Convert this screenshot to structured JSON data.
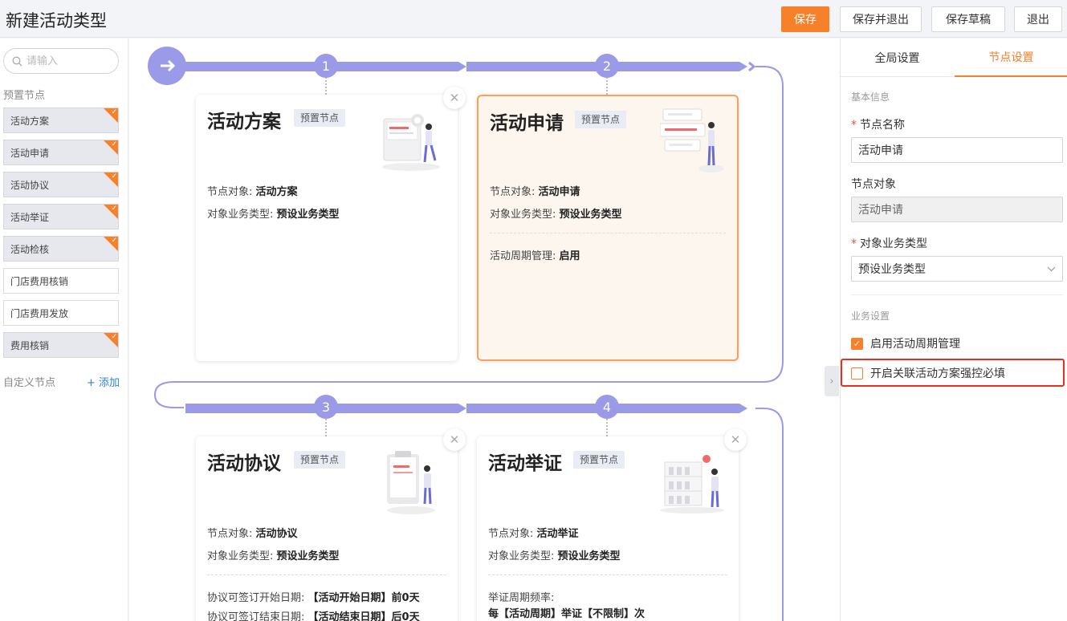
{
  "header": {
    "title": "新建活动类型",
    "save_label": "保存",
    "save_exit_label": "保存并退出",
    "save_draft_label": "保存草稿",
    "exit_label": "退出"
  },
  "sidebar": {
    "search_placeholder": "请输入",
    "preset_label": "预置节点",
    "custom_label": "自定义节点",
    "add_label": "+ 添加",
    "items": [
      {
        "label": "活动方案",
        "preset": true
      },
      {
        "label": "活动申请",
        "preset": true
      },
      {
        "label": "活动协议",
        "preset": true
      },
      {
        "label": "活动举证",
        "preset": true
      },
      {
        "label": "活动检核",
        "preset": true
      },
      {
        "label": "门店费用核销",
        "preset": false
      },
      {
        "label": "门店费用发放",
        "preset": false
      },
      {
        "label": "费用核销",
        "preset": true
      }
    ]
  },
  "flow": {
    "steps": [
      "1",
      "2",
      "3",
      "4"
    ],
    "cards": [
      {
        "title": "活动方案",
        "tag": "预置节点",
        "object_label": "节点对象:",
        "object_value": "活动方案",
        "biz_label": "对象业务类型:",
        "biz_value": "预设业务类型"
      },
      {
        "title": "活动申请",
        "tag": "预置节点",
        "object_label": "节点对象:",
        "object_value": "活动申请",
        "biz_label": "对象业务类型:",
        "biz_value": "预设业务类型",
        "extra_label": "活动周期管理:",
        "extra_value": "启用"
      },
      {
        "title": "活动协议",
        "tag": "预置节点",
        "object_label": "节点对象:",
        "object_value": "活动协议",
        "biz_label": "对象业务类型:",
        "biz_value": "预设业务类型",
        "extra_label": "协议可签订开始日期:",
        "extra_value": "【活动开始日期】前0天",
        "extra2_label": "协议可签订结束日期:",
        "extra2_value": "【活动结束日期】后0天"
      },
      {
        "title": "活动举证",
        "tag": "预置节点",
        "object_label": "节点对象:",
        "object_value": "活动举证",
        "biz_label": "对象业务类型:",
        "biz_value": "预设业务类型",
        "extra_label": "举证周期频率:",
        "extra_value": "每【活动周期】举证【不限制】次"
      }
    ]
  },
  "right_panel": {
    "tabs": [
      "全局设置",
      "节点设置"
    ],
    "basic_info": "基本信息",
    "node_name_label": "节点名称",
    "node_name_value": "活动申请",
    "node_object_label": "节点对象",
    "node_object_value": "活动申请",
    "biz_type_label": "对象业务类型",
    "biz_type_value": "预设业务类型",
    "biz_settings": "业务设置",
    "check1_label": "启用活动周期管理",
    "check2_label": "开启关联活动方案强控必填"
  },
  "colors": {
    "accent": "#f7812a",
    "flow": "#9a9ae8",
    "highlight": "#e8301f"
  }
}
